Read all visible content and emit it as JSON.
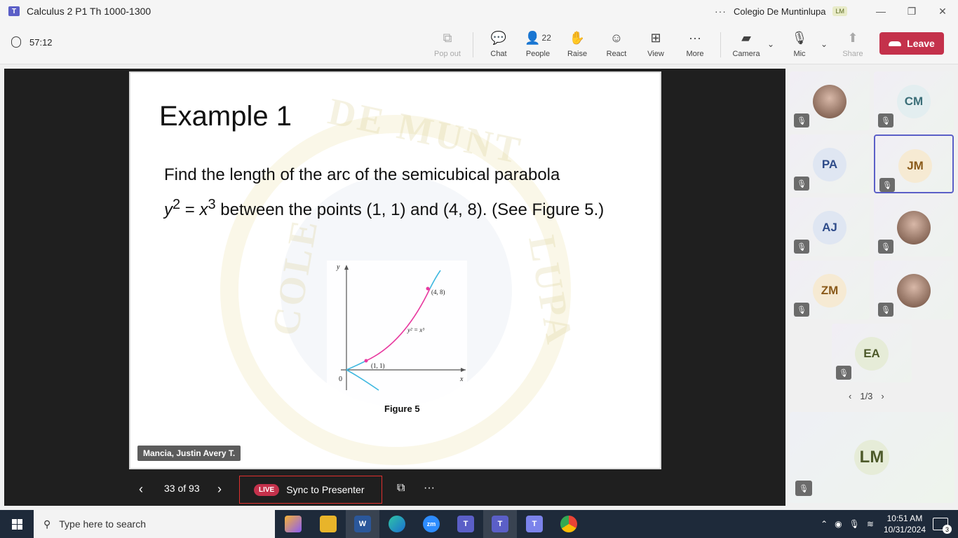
{
  "window": {
    "title": "Calculus 2 P1 Th 1000-1300",
    "org": "Colegio De Muntinlupa",
    "user_initials": "LM"
  },
  "toolbar": {
    "timer": "57:12",
    "popout": "Pop out",
    "chat": "Chat",
    "people": "People",
    "people_count": "22",
    "raise": "Raise",
    "react": "React",
    "view": "View",
    "more": "More",
    "camera": "Camera",
    "mic": "Mic",
    "share": "Share",
    "leave": "Leave"
  },
  "slide": {
    "title": "Example 1",
    "line1": "Find the length of the arc of the semicubical parabola",
    "line2_rest": " between the points (1, 1) and (4, 8). (See Figure 5.)",
    "figure_caption": "Figure 5",
    "fig_point_a": "(1, 1)",
    "fig_point_b": "(4, 8)",
    "fig_axis_x": "x",
    "fig_axis_y": "y",
    "fig_origin": "0",
    "watermark_top": "DE MUNT",
    "watermark_left": "COLE",
    "watermark_right": "LUPA",
    "presenter": "Mancia, Justin Avery T."
  },
  "slide_nav": {
    "page": "33 of 93",
    "live": "LIVE",
    "sync": "Sync to Presenter"
  },
  "participants": [
    {
      "initials": "",
      "photo": true
    },
    {
      "initials": "CM",
      "bg": "#e3eef0",
      "fg": "#3b6e78"
    },
    {
      "initials": "PA",
      "bg": "#dfe6f2",
      "fg": "#2f4c8a"
    },
    {
      "initials": "JM",
      "bg": "#f6ead3",
      "fg": "#8a5a1a"
    },
    {
      "initials": "AJ",
      "bg": "#dfe6f2",
      "fg": "#2f4c8a"
    },
    {
      "initials": "",
      "photo": true
    },
    {
      "initials": "ZM",
      "bg": "#f6ead3",
      "fg": "#8a5a1a"
    },
    {
      "initials": "",
      "photo": true
    },
    {
      "initials": "EA",
      "bg": "#e6ecd8",
      "fg": "#4d5a2a"
    }
  ],
  "pager": "1/3",
  "self_tile": "LM",
  "taskbar": {
    "search_placeholder": "Type here to search",
    "time": "10:51 AM",
    "date": "10/31/2024",
    "notifications": "3"
  }
}
